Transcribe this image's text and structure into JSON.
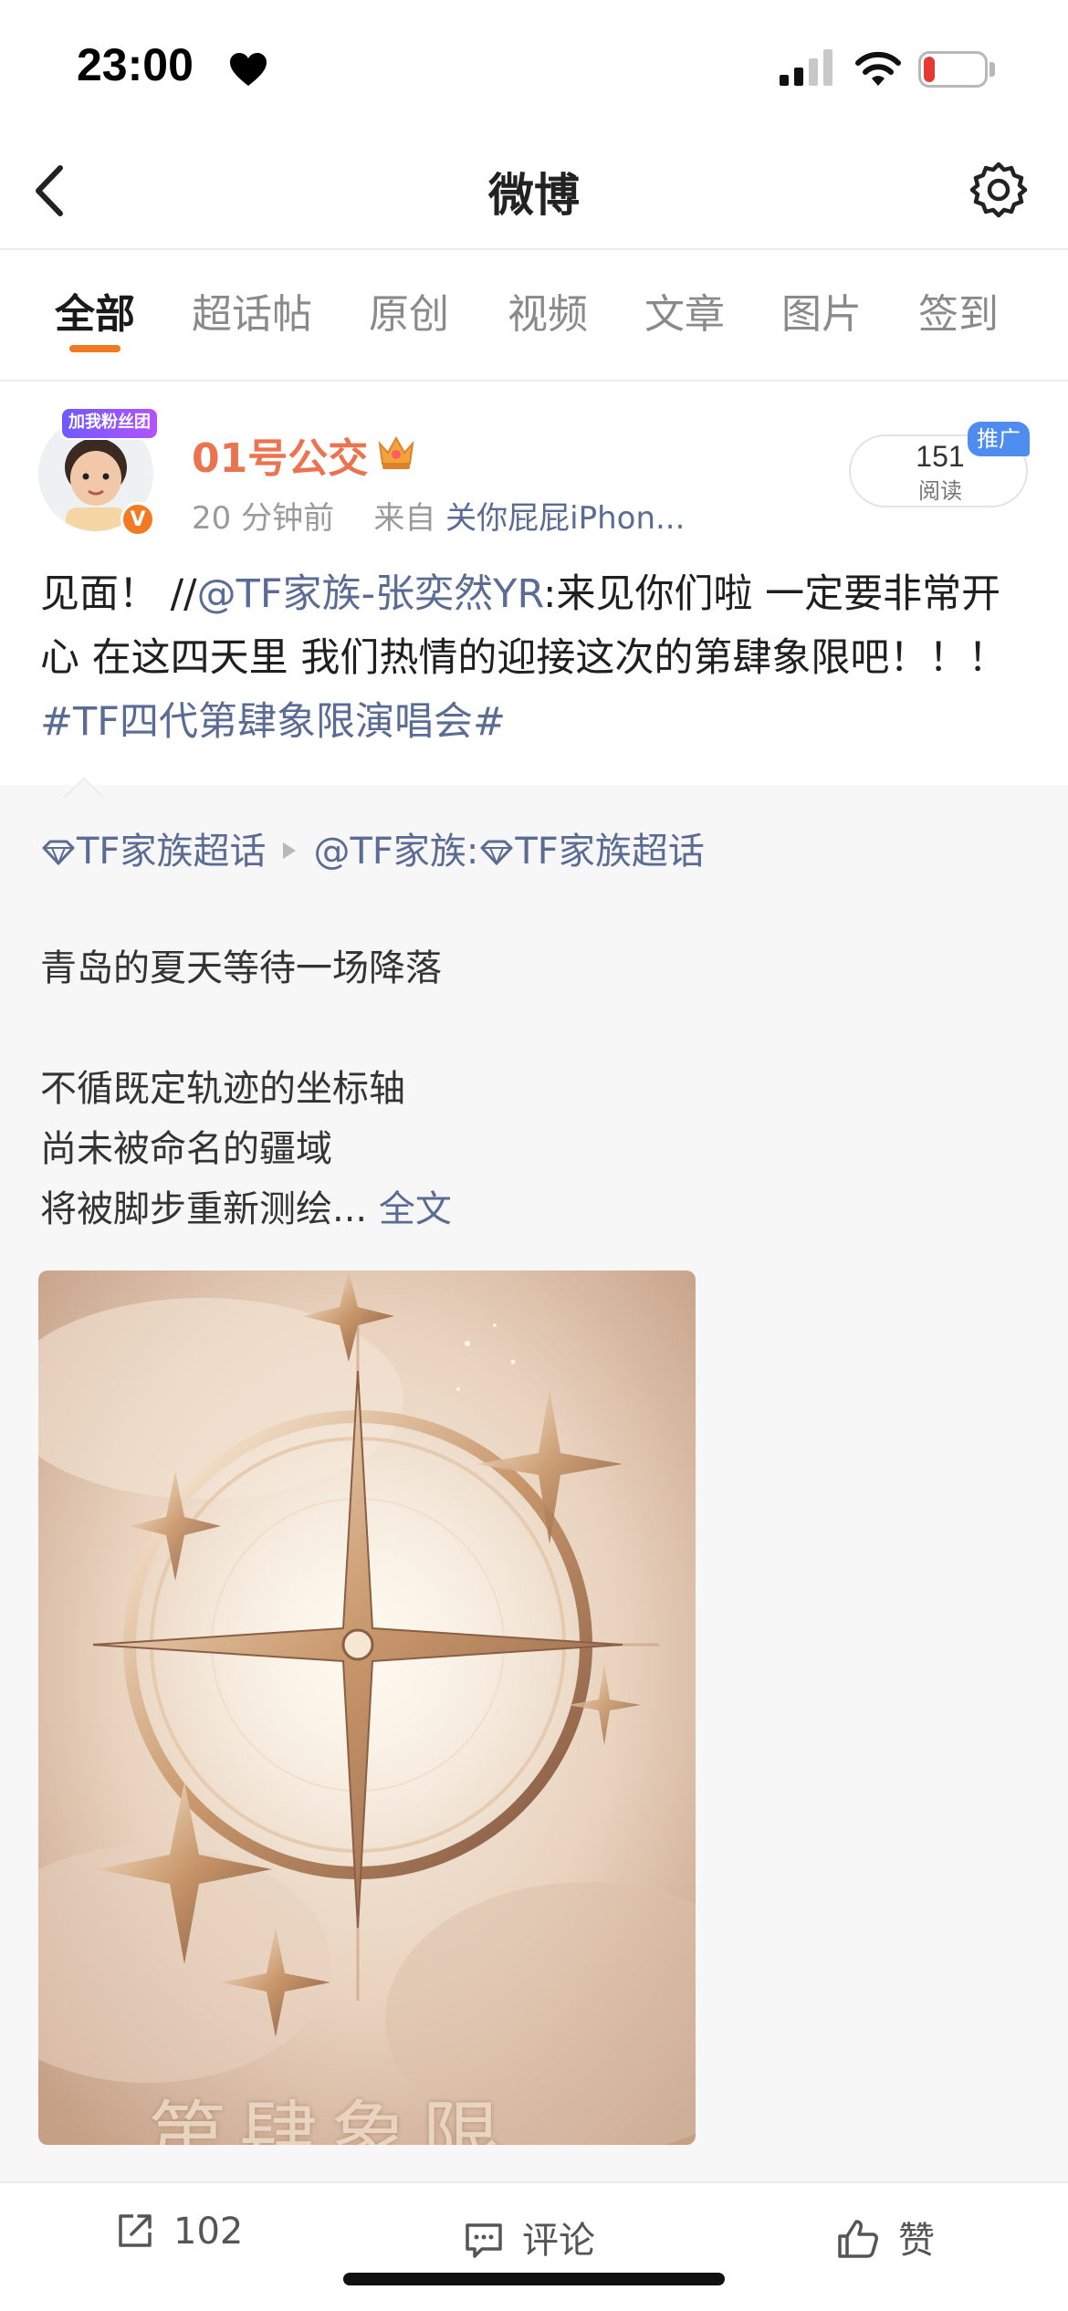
{
  "status_bar": {
    "time": "23:00",
    "battery": "4"
  },
  "nav": {
    "title": "微博"
  },
  "tabs": [
    {
      "label": "全部"
    },
    {
      "label": "超话帖"
    },
    {
      "label": "原创"
    },
    {
      "label": "视频"
    },
    {
      "label": "文章"
    },
    {
      "label": "图片"
    },
    {
      "label": "签到"
    }
  ],
  "post": {
    "avatar_badge": "加我粉丝团",
    "verified": "V",
    "username": "01号公交",
    "time_ago": "20 分钟前",
    "source_prefix": "来自",
    "source": "关你屁屁iPhon...",
    "read_count": "151",
    "read_label": "阅读",
    "promo": "推广",
    "text_before": "见面！ //",
    "mention": "@TF家族-张奕然YR",
    "text_after": ":来见你们啦 一定要非常开心 在这四天里 我们热情的迎接这次的第肆象限吧！！！ ",
    "hashtag": "#TF四代第肆象限演唱会#"
  },
  "repost": {
    "topic": "TF家族超话",
    "author": "@TF家族:",
    "topic2": "TF家族超话",
    "para1": "青岛的夏天等待一场降落",
    "para2_line1": "不循既定轨迹的坐标轴",
    "para2_line2": "尚未被命名的疆域",
    "para2_line3": "将被脚步重新测绘...",
    "more": "全文",
    "image_title": "第肆象限"
  },
  "actions": {
    "share_count": "102",
    "comment_label": "评论",
    "like_label": "赞"
  },
  "colors": {
    "accent": "#f07b22",
    "link": "#5a6b94",
    "username": "#eb7350"
  }
}
